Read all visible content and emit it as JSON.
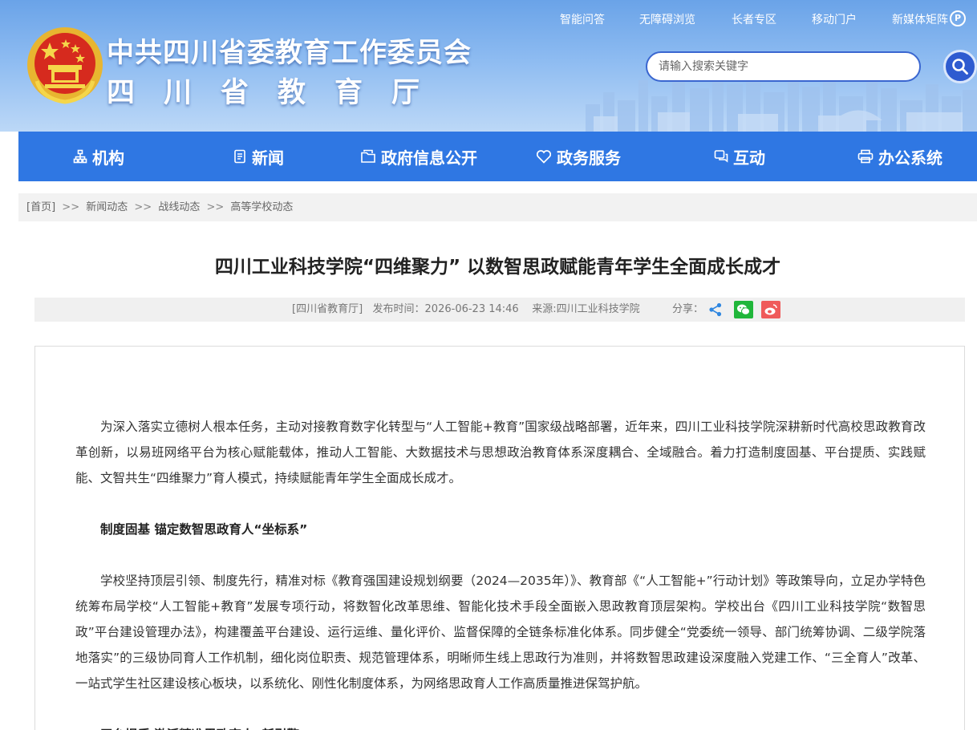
{
  "header": {
    "org_title": "中共四川省委教育工作委员会",
    "dept_title": "四川省教育厅",
    "top_links": [
      "智能问答",
      "无障碍浏览",
      "长者专区",
      "移动门户",
      "新媒体矩阵"
    ],
    "search_placeholder": "请输入搜索关键字",
    "colors": {
      "nav_bg": "#2f77e3",
      "search_btn": "#2e5bd0"
    }
  },
  "nav": {
    "items": [
      {
        "label": "机构",
        "icon": "org-chart-icon"
      },
      {
        "label": "新闻",
        "icon": "document-icon"
      },
      {
        "label": "政府信息公开",
        "icon": "folder-icon"
      },
      {
        "label": "政务服务",
        "icon": "heart-icon"
      },
      {
        "label": "互动",
        "icon": "chat-icon"
      },
      {
        "label": "办公系统",
        "icon": "printer-icon"
      }
    ]
  },
  "breadcrumb": {
    "home": "[首页]",
    "sep": ">>",
    "items": [
      "新闻动态",
      "战线动态",
      "高等学校动态"
    ]
  },
  "article": {
    "title": "四川工业科技学院“四维聚力” 以数智思政赋能青年学生全面成长成才",
    "meta": "[四川省教育厅]   发布时间：2026-06-23 14:46    来源:四川工业科技学院",
    "share_label": "分享：",
    "share_icons": [
      "share-icon",
      "wechat-icon",
      "weibo-icon"
    ],
    "paragraphs": [
      "为深入落实立德树人根本任务，主动对接教育数字化转型与“人工智能+教育”国家级战略部署，近年来，四川工业科技学院深耕新时代高校思政教育改革创新，以易班网络平台为核心赋能载体，推动人工智能、大数据技术与思想政治教育体系深度耦合、全域融合。着力打造制度固基、平台提质、实践赋能、文智共生“四维聚力”育人模式，持续赋能青年学生全面成长成才。",
      "制度固基 锚定数智思政育人“坐标系”",
      "学校坚持顶层引领、制度先行，精准对标《教育强国建设规划纲要（2024—2035年）》、教育部《“人工智能+”行动计划》等政策导向，立足办学特色统筹布局学校“人工智能+教育”发展专项行动，将数智化改革思维、智能化技术手段全面嵌入思政教育顶层架构。学校出台《四川工业科技学院“数智思政”平台建设管理办法》，构建覆盖平台建设、运行运维、量化评价、监督保障的全链条标准化体系。同步健全“党委统一领导、部门统筹协调、二级学院落地落实”的三级协同育人工作机制，细化岗位职责、规范管理体系，明晰师生线上思政行为准则，并将数智思政建设深度融入党建工作、“三全育人”改革、一站式学生社区建设核心板块，以系统化、刚性化制度体系，为网络思政育人工作高质量推进保驾护航。",
      "平台提质 激活精准思政育人“新引擎”"
    ]
  }
}
